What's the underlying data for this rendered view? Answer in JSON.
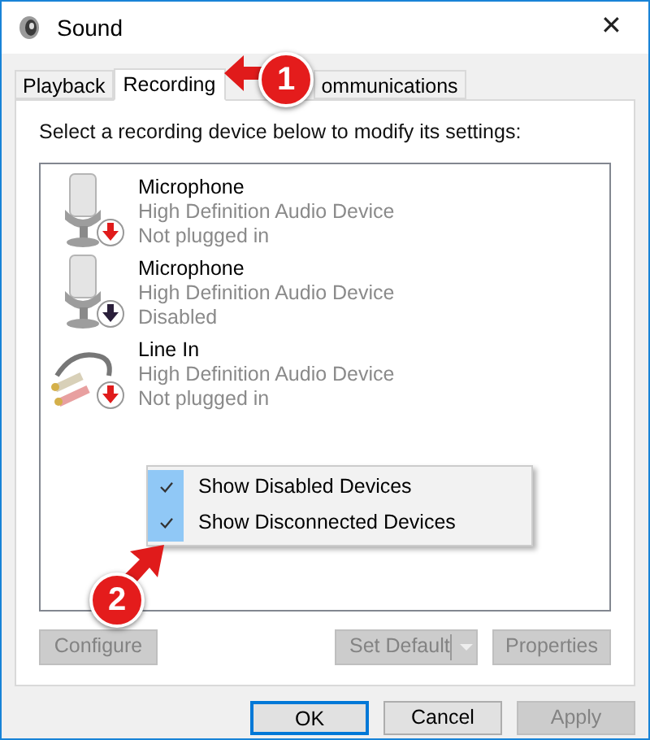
{
  "window": {
    "title": "Sound",
    "close": "✕"
  },
  "tabs": [
    {
      "label": "Playback",
      "selected": false
    },
    {
      "label": "Recording",
      "selected": true
    },
    {
      "label": "ommunications",
      "selected": false
    }
  ],
  "instruction": "Select a recording device below to modify its settings:",
  "devices": [
    {
      "kind": "microphone",
      "name": "Microphone",
      "driver": "High Definition Audio Device",
      "status": "Not plugged in",
      "disabled": false
    },
    {
      "kind": "microphone",
      "name": "Microphone",
      "driver": "High Definition Audio Device",
      "status": "Disabled",
      "disabled": true
    },
    {
      "kind": "line-in",
      "name": "Line In",
      "driver": "High Definition Audio Device",
      "status": "Not plugged in",
      "disabled": false
    }
  ],
  "context_menu": [
    {
      "label": "Show Disabled Devices",
      "checked": true
    },
    {
      "label": "Show Disconnected Devices",
      "checked": true
    }
  ],
  "device_buttons": [
    {
      "label": "Configure",
      "disabled": true,
      "kind": "plain"
    },
    {
      "label": "Set Default",
      "disabled": true,
      "kind": "split"
    },
    {
      "label": "Properties",
      "disabled": true,
      "kind": "plain"
    }
  ],
  "dialog_buttons": [
    {
      "label": "OK",
      "disabled": false,
      "default": true
    },
    {
      "label": "Cancel",
      "disabled": false,
      "default": false
    },
    {
      "label": "Apply",
      "disabled": true,
      "default": false
    }
  ],
  "annotations": [
    {
      "label": "1"
    },
    {
      "label": "2"
    }
  ]
}
